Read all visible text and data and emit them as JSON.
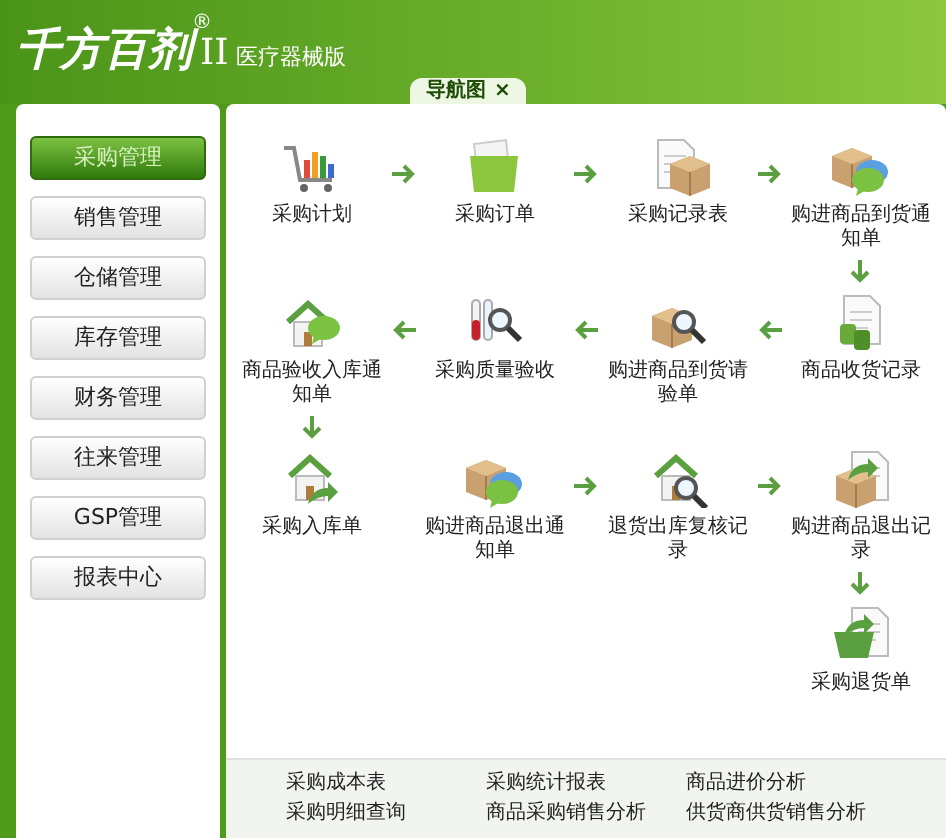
{
  "app": {
    "logo": "千方百剂",
    "edition_mark": "II",
    "registered": "®",
    "edition": "医疗器械版"
  },
  "tabs": [
    {
      "label": "导航图",
      "close": "×",
      "selected": true
    }
  ],
  "sidebar": {
    "items": [
      {
        "label": "采购管理",
        "selected": true
      },
      {
        "label": "销售管理",
        "selected": false
      },
      {
        "label": "仓储管理",
        "selected": false
      },
      {
        "label": "库存管理",
        "selected": false
      },
      {
        "label": "财务管理",
        "selected": false
      },
      {
        "label": "往来管理",
        "selected": false
      },
      {
        "label": "GSP管理",
        "selected": false
      },
      {
        "label": "报表中心",
        "selected": false
      }
    ]
  },
  "flow": {
    "rows": [
      {
        "kind": "right",
        "items": [
          {
            "kind": "step",
            "label": "采购计划"
          },
          {
            "kind": "arrow"
          },
          {
            "kind": "step",
            "label": "采购订单"
          },
          {
            "kind": "arrow"
          },
          {
            "kind": "step",
            "label": "采购记录表"
          },
          {
            "kind": "arrow"
          },
          {
            "kind": "step",
            "label": "购进商品到货通知单"
          }
        ]
      },
      {
        "kind": "left",
        "items": [
          {
            "kind": "step",
            "label": "商品验收入库通知单"
          },
          {
            "kind": "arrow"
          },
          {
            "kind": "step",
            "label": "采购质量验收"
          },
          {
            "kind": "arrow"
          },
          {
            "kind": "step",
            "label": "购进商品到货请验单"
          },
          {
            "kind": "arrow"
          },
          {
            "kind": "step",
            "label": "商品收货记录"
          }
        ]
      },
      {
        "kind": "right",
        "items": [
          {
            "kind": "step",
            "label": "采购入库单"
          },
          {
            "kind": "step",
            "label": "购进商品退出通知单"
          },
          {
            "kind": "arrow"
          },
          {
            "kind": "step",
            "label": "退货出库复核记录"
          },
          {
            "kind": "arrow"
          },
          {
            "kind": "step",
            "label": "购进商品退出记录"
          }
        ]
      },
      {
        "kind": "right",
        "items": [
          {
            "kind": "step",
            "label": "采购退货单"
          }
        ]
      }
    ]
  },
  "footer_links": [
    "采购成本表",
    "采购明细查询",
    "采购统计报表",
    "商品采购销售分析",
    "商品进价分析",
    "供货商供货销售分析"
  ]
}
